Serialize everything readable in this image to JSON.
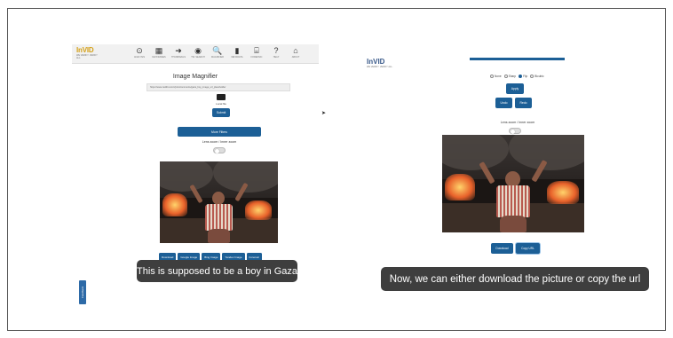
{
  "toolbar": {
    "logo_text_1": "InVID",
    "logo_sub": "WE VERIFY. VERIFY ALL.",
    "items": [
      {
        "label": "ANALYSIS",
        "icon": "play-circle-icon",
        "glyph": "⊙"
      },
      {
        "label": "KEYFRAMES",
        "icon": "film-icon",
        "glyph": "▦"
      },
      {
        "label": "THUMBNAILS",
        "icon": "thumbnails-icon",
        "glyph": "➜"
      },
      {
        "label": "TW. SEARCH",
        "icon": "twitter-search-icon",
        "glyph": "◉"
      },
      {
        "label": "MAGNIFIER",
        "icon": "magnifier-icon",
        "glyph": "🔍"
      },
      {
        "label": "METADATA",
        "icon": "document-icon",
        "glyph": "▮"
      },
      {
        "label": "FORENSIC",
        "icon": "forensic-icon",
        "glyph": "⌸"
      },
      {
        "label": "HELP",
        "icon": "help-icon",
        "glyph": "?"
      },
      {
        "label": "ABOUT",
        "icon": "about-icon",
        "glyph": "⌂"
      }
    ]
  },
  "magnifier": {
    "title": "Image Magnifier",
    "url": "https://www.reddit.com/r/pics/comments/gaza_boy_image_url_placeholder",
    "local_file_label": "Local file",
    "submit_label": "Submit",
    "more_filters_label": "More Filters",
    "lens_zoom_label": "Lens zoom / Inner zoom"
  },
  "actions": {
    "buttons": [
      "Download",
      "Google Image",
      "Bing Image",
      "Yandex Image",
      "Forensic"
    ]
  },
  "caption_left": "This is supposed to be a boy in Gaza",
  "feedback_label": "Feedback",
  "right": {
    "logo_text": "InVID",
    "logo_sub": "WE VERIFY. VERIFY ALL.",
    "radio_options": [
      {
        "label": "None",
        "selected": false
      },
      {
        "label": "Sharp",
        "selected": false
      },
      {
        "label": "Flip",
        "selected": true
      },
      {
        "label": "Bicubic",
        "selected": false
      }
    ],
    "apply_label": "Apply",
    "undo_label": "Undo",
    "redo_label": "Redo",
    "lens_zoom_label": "Lens zoom / Inner zoom",
    "download_label": "Download",
    "copy_url_label": "Copy URL"
  },
  "caption_right": "Now, we can either download the picture or copy the url",
  "colors": {
    "primary_button": "#1c5f96",
    "caption_bg": "#3e3e3e"
  }
}
